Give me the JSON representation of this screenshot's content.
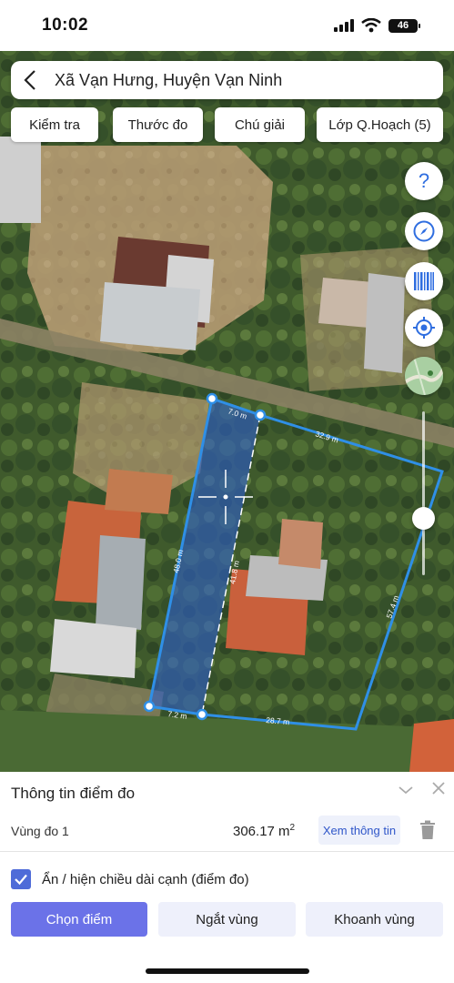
{
  "status_bar": {
    "time": "10:02",
    "battery": "46"
  },
  "search": {
    "title": "Xã Vạn Hưng, Huyện Vạn Ninh"
  },
  "top_buttons": [
    "Kiểm tra",
    "Thước đo",
    "Chú giải",
    "Lớp Q.Hoạch (5)"
  ],
  "map": {
    "edge_labels": [
      "7.0 m",
      "32.9 m",
      "57.4 m",
      "28.7 m",
      "7.2 m",
      "48.0 m",
      "41.8 m"
    ],
    "colors": {
      "measure_line": "#2f8fe6",
      "selected_fill": "#2e60c8"
    }
  },
  "right_controls": [
    "help-icon",
    "compass-icon",
    "barcode-icon",
    "locate-icon",
    "map-layer-icon"
  ],
  "panel": {
    "title": "Thông tin điểm đo",
    "zone_name": "Vùng đo 1",
    "zone_area_value": "306.17 m",
    "zone_area_unit_sup": "2",
    "view_info_label": "Xem thông tin",
    "toggle_label": "Ẩn / hiện chiều dài cạnh (điểm đo)",
    "toggle_checked": true,
    "actions": {
      "select_point": "Chọn điểm",
      "break_zone": "Ngắt vùng",
      "enclose_zone": "Khoanh vùng"
    },
    "colors": {
      "primary": "#6b72e8",
      "secondary": "#eef0fb"
    }
  }
}
